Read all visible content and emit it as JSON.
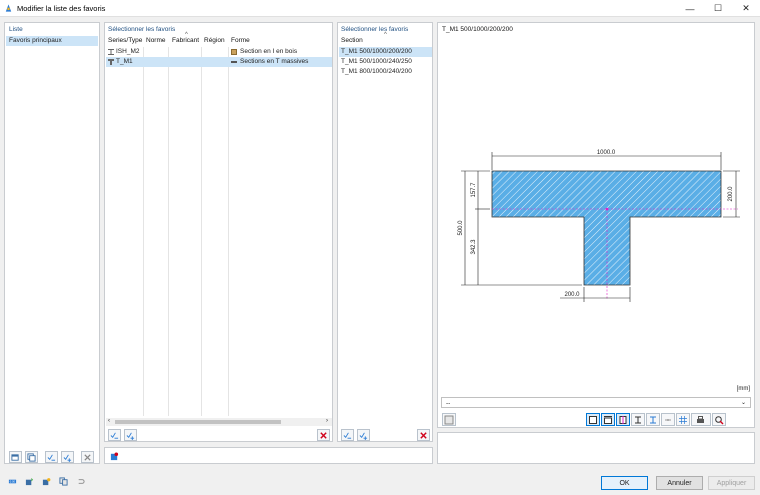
{
  "window": {
    "title": "Modifier la liste des favoris"
  },
  "list_panel": {
    "title": "Liste",
    "items": [
      "Favoris principaux"
    ]
  },
  "favorites_panel": {
    "title": "Sélectionner les favoris",
    "columns": [
      "Series/Type",
      "Norme",
      "Fabricant",
      "Région",
      "Forme"
    ],
    "rows": [
      {
        "name": "ISH_M2",
        "norme": "",
        "fabricant": "",
        "region": "",
        "forme": "Section en I en bois"
      },
      {
        "name": "T_M1",
        "norme": "",
        "fabricant": "",
        "region": "",
        "forme": "Sections en T massives"
      }
    ]
  },
  "section_panel": {
    "title": "Sélectionner les favoris",
    "column": "Section",
    "rows": [
      "T_M1 500/1000/200/200",
      "T_M1 500/1000/240/250",
      "T_M1 800/1000/240/200"
    ]
  },
  "preview": {
    "title": "T_M1 500/1000/200/200",
    "dims": {
      "width": "1000.0",
      "height": "500.0",
      "flange": "200.0",
      "web": "200.0",
      "top": "157.7",
      "bottom": "342.3"
    },
    "unit": "[mm]",
    "dropdown_value": "--"
  },
  "buttons": {
    "ok": "OK",
    "cancel": "Annuler",
    "apply": "Appliquer"
  },
  "colors": {
    "accent": "#0078d7",
    "selection": "#cce4f7",
    "hatch": "#5aaee6",
    "delete": "#d0021b",
    "centroid": "#e01ec8"
  }
}
